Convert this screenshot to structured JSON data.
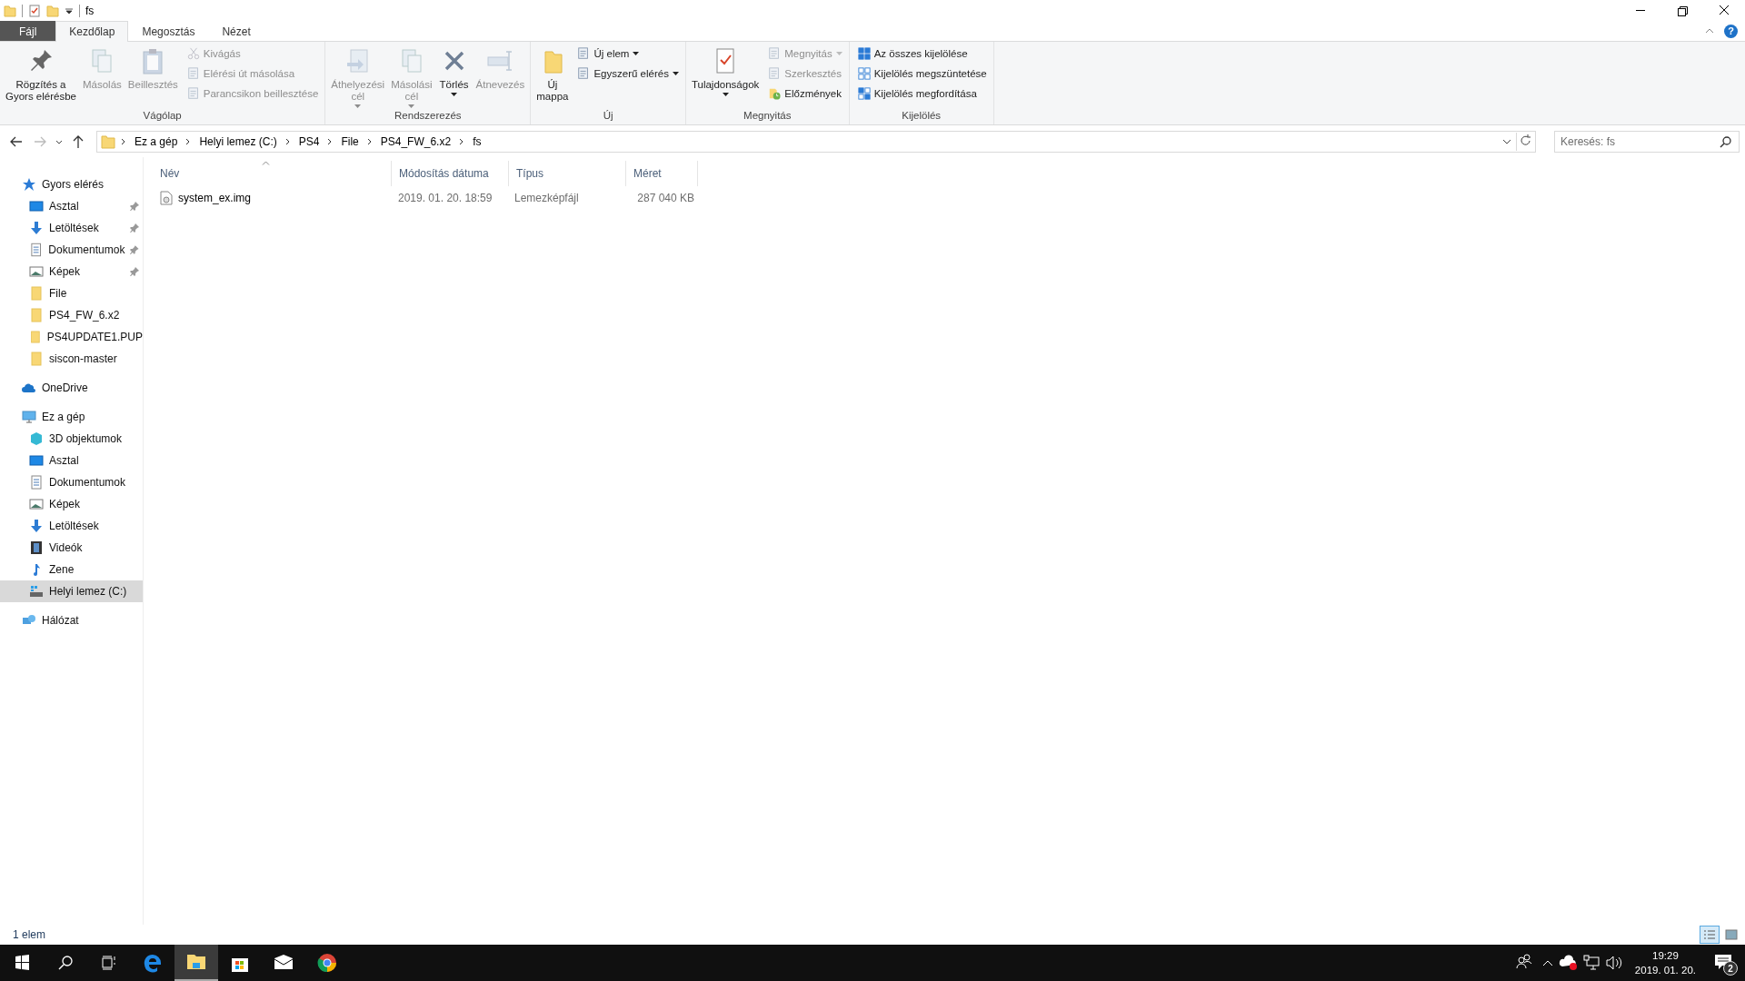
{
  "window": {
    "title": "fs",
    "help": "?"
  },
  "ribbon_tabs": [
    {
      "label": "Fájl",
      "kind": "file",
      "selected": false
    },
    {
      "label": "Kezdőlap",
      "kind": "tab",
      "selected": true
    },
    {
      "label": "Megosztás",
      "kind": "tab",
      "selected": false
    },
    {
      "label": "Nézet",
      "kind": "tab",
      "selected": false
    }
  ],
  "ribbon_groups": [
    {
      "label": "Vágólap",
      "items": [
        {
          "kind": "large",
          "label": "Rögzítés a\nGyors elérésbe",
          "disabled": false,
          "dropdown": false
        },
        {
          "kind": "large",
          "label": "Másolás",
          "disabled": true,
          "dropdown": false
        },
        {
          "kind": "large",
          "label": "Beillesztés",
          "disabled": true,
          "dropdown": false
        },
        {
          "kind": "small",
          "label": "Kivágás",
          "disabled": true,
          "dropdown": false
        },
        {
          "kind": "small",
          "label": "Elérési út másolása",
          "disabled": true,
          "dropdown": false
        },
        {
          "kind": "small",
          "label": "Parancsikon beillesztése",
          "disabled": true,
          "dropdown": false
        }
      ]
    },
    {
      "label": "Rendszerezés",
      "items": [
        {
          "kind": "large",
          "label": "Áthelyezési\ncél",
          "disabled": true,
          "dropdown": true
        },
        {
          "kind": "large",
          "label": "Másolási\ncél",
          "disabled": true,
          "dropdown": true
        },
        {
          "kind": "large",
          "label": "Törlés",
          "disabled": false,
          "dropdown": true
        },
        {
          "kind": "large",
          "label": "Átnevezés",
          "disabled": true,
          "dropdown": false
        }
      ]
    },
    {
      "label": "Új",
      "items": [
        {
          "kind": "large",
          "label": "Új\nmappa",
          "disabled": false,
          "dropdown": false
        },
        {
          "kind": "small",
          "label": "Új elem",
          "disabled": false,
          "dropdown": true
        },
        {
          "kind": "small",
          "label": "Egyszerű elérés",
          "disabled": false,
          "dropdown": true
        }
      ]
    },
    {
      "label": "Megnyitás",
      "items": [
        {
          "kind": "large",
          "label": "Tulajdonságok",
          "disabled": false,
          "dropdown": true
        },
        {
          "kind": "small",
          "label": "Megnyitás",
          "disabled": true,
          "dropdown": true
        },
        {
          "kind": "small",
          "label": "Szerkesztés",
          "disabled": true,
          "dropdown": false
        },
        {
          "kind": "small",
          "label": "Előzmények",
          "disabled": false,
          "dropdown": false
        }
      ]
    },
    {
      "label": "Kijelölés",
      "items": [
        {
          "kind": "small",
          "label": "Az összes kijelölése",
          "disabled": false,
          "dropdown": false
        },
        {
          "kind": "small",
          "label": "Kijelölés megszüntetése",
          "disabled": false,
          "dropdown": false
        },
        {
          "kind": "small",
          "label": "Kijelölés megfordítása",
          "disabled": false,
          "dropdown": false
        }
      ]
    }
  ],
  "breadcrumb": [
    "Ez a gép",
    "Helyi lemez (C:)",
    "PS4",
    "File",
    "PS4_FW_6.x2",
    "fs"
  ],
  "search": {
    "placeholder": "Keresés: fs"
  },
  "sidebar": [
    {
      "label": "Gyors elérés",
      "selected": false,
      "children": [
        {
          "label": "Asztal",
          "pinned": true,
          "selected": false
        },
        {
          "label": "Letöltések",
          "pinned": true,
          "selected": false
        },
        {
          "label": "Dokumentumok",
          "pinned": true,
          "selected": false
        },
        {
          "label": "Képek",
          "pinned": true,
          "selected": false
        },
        {
          "label": "File",
          "pinned": false,
          "selected": false
        },
        {
          "label": "PS4_FW_6.x2",
          "pinned": false,
          "selected": false
        },
        {
          "label": "PS4UPDATE1.PUP",
          "pinned": false,
          "selected": false
        },
        {
          "label": "siscon-master",
          "pinned": false,
          "selected": false
        }
      ]
    },
    {
      "label": "OneDrive",
      "selected": false
    },
    {
      "label": "Ez a gép",
      "selected": false,
      "children": [
        {
          "label": "3D objektumok",
          "pinned": false,
          "selected": false
        },
        {
          "label": "Asztal",
          "pinned": false,
          "selected": false
        },
        {
          "label": "Dokumentumok",
          "pinned": false,
          "selected": false
        },
        {
          "label": "Képek",
          "pinned": false,
          "selected": false
        },
        {
          "label": "Letöltések",
          "pinned": false,
          "selected": false
        },
        {
          "label": "Videók",
          "pinned": false,
          "selected": false
        },
        {
          "label": "Zene",
          "pinned": false,
          "selected": false
        },
        {
          "label": "Helyi lemez (C:)",
          "pinned": false,
          "selected": true
        }
      ]
    },
    {
      "label": "Hálózat",
      "selected": false
    }
  ],
  "table": {
    "columns": [
      {
        "label": "Név",
        "sorted": true
      },
      {
        "label": "Módosítás dátuma",
        "sorted": false
      },
      {
        "label": "Típus",
        "sorted": false
      },
      {
        "label": "Méret",
        "sorted": false
      }
    ],
    "rows": [
      {
        "name": "system_ex.img",
        "modified": "2019. 01. 20. 18:59",
        "type": "Lemezképfájl",
        "size": "287 040 KB",
        "selected": false
      }
    ]
  },
  "status_bar": {
    "count": "1 elem",
    "views": [
      {
        "kind": "details",
        "selected": true
      },
      {
        "kind": "thumbnails",
        "selected": false
      }
    ]
  },
  "taskbar": {
    "apps": [
      {
        "kind": "edge",
        "selected": false
      },
      {
        "kind": "explorer",
        "selected": true
      },
      {
        "kind": "store",
        "selected": false
      },
      {
        "kind": "mail",
        "selected": false
      },
      {
        "kind": "chrome",
        "selected": false
      }
    ],
    "time": "19:29",
    "date": "2019. 01. 20.",
    "notifications": "2"
  }
}
